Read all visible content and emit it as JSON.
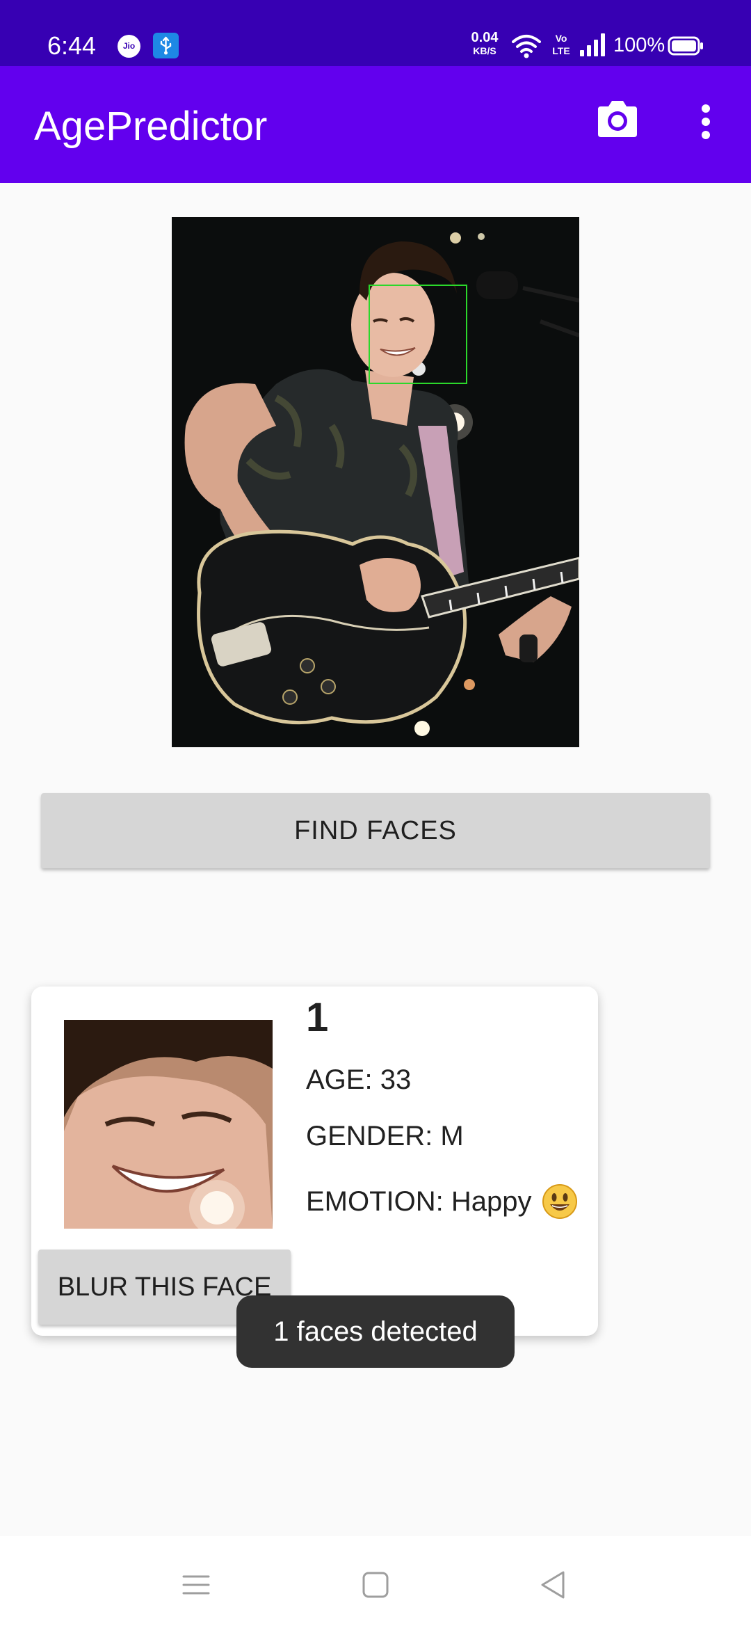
{
  "status_bar": {
    "time": "6:44",
    "network_speed_value": "0.04",
    "network_speed_unit": "KB/S",
    "volte_top": "Vo",
    "volte_bottom": "LTE",
    "battery": "100%",
    "icons": [
      "jio-icon",
      "usb-debug-icon",
      "wifi-icon",
      "volte-icon",
      "signal-icon",
      "battery-icon"
    ]
  },
  "app_bar": {
    "title": "AgePredictor",
    "actions": [
      "camera-icon",
      "more-vert-icon"
    ]
  },
  "main": {
    "find_faces_label": "FIND FACES"
  },
  "face_card": {
    "number": "1",
    "age": "AGE: 33",
    "gender": "GENDER: M",
    "emotion": "EMOTION: Happy",
    "emotion_icon": "smiling-face-emoji",
    "blur_label": "BLUR THIS FACE"
  },
  "toast": {
    "message": "1 faces detected"
  },
  "nav_bar": {
    "icons": [
      "menu-icon",
      "home-icon",
      "back-icon"
    ]
  },
  "colors": {
    "status_bar": "#3700b3",
    "app_bar": "#6200ee",
    "background": "#fafafa",
    "button": "#d6d6d6",
    "face_box": "#2bd82b",
    "toast": "#323232"
  }
}
